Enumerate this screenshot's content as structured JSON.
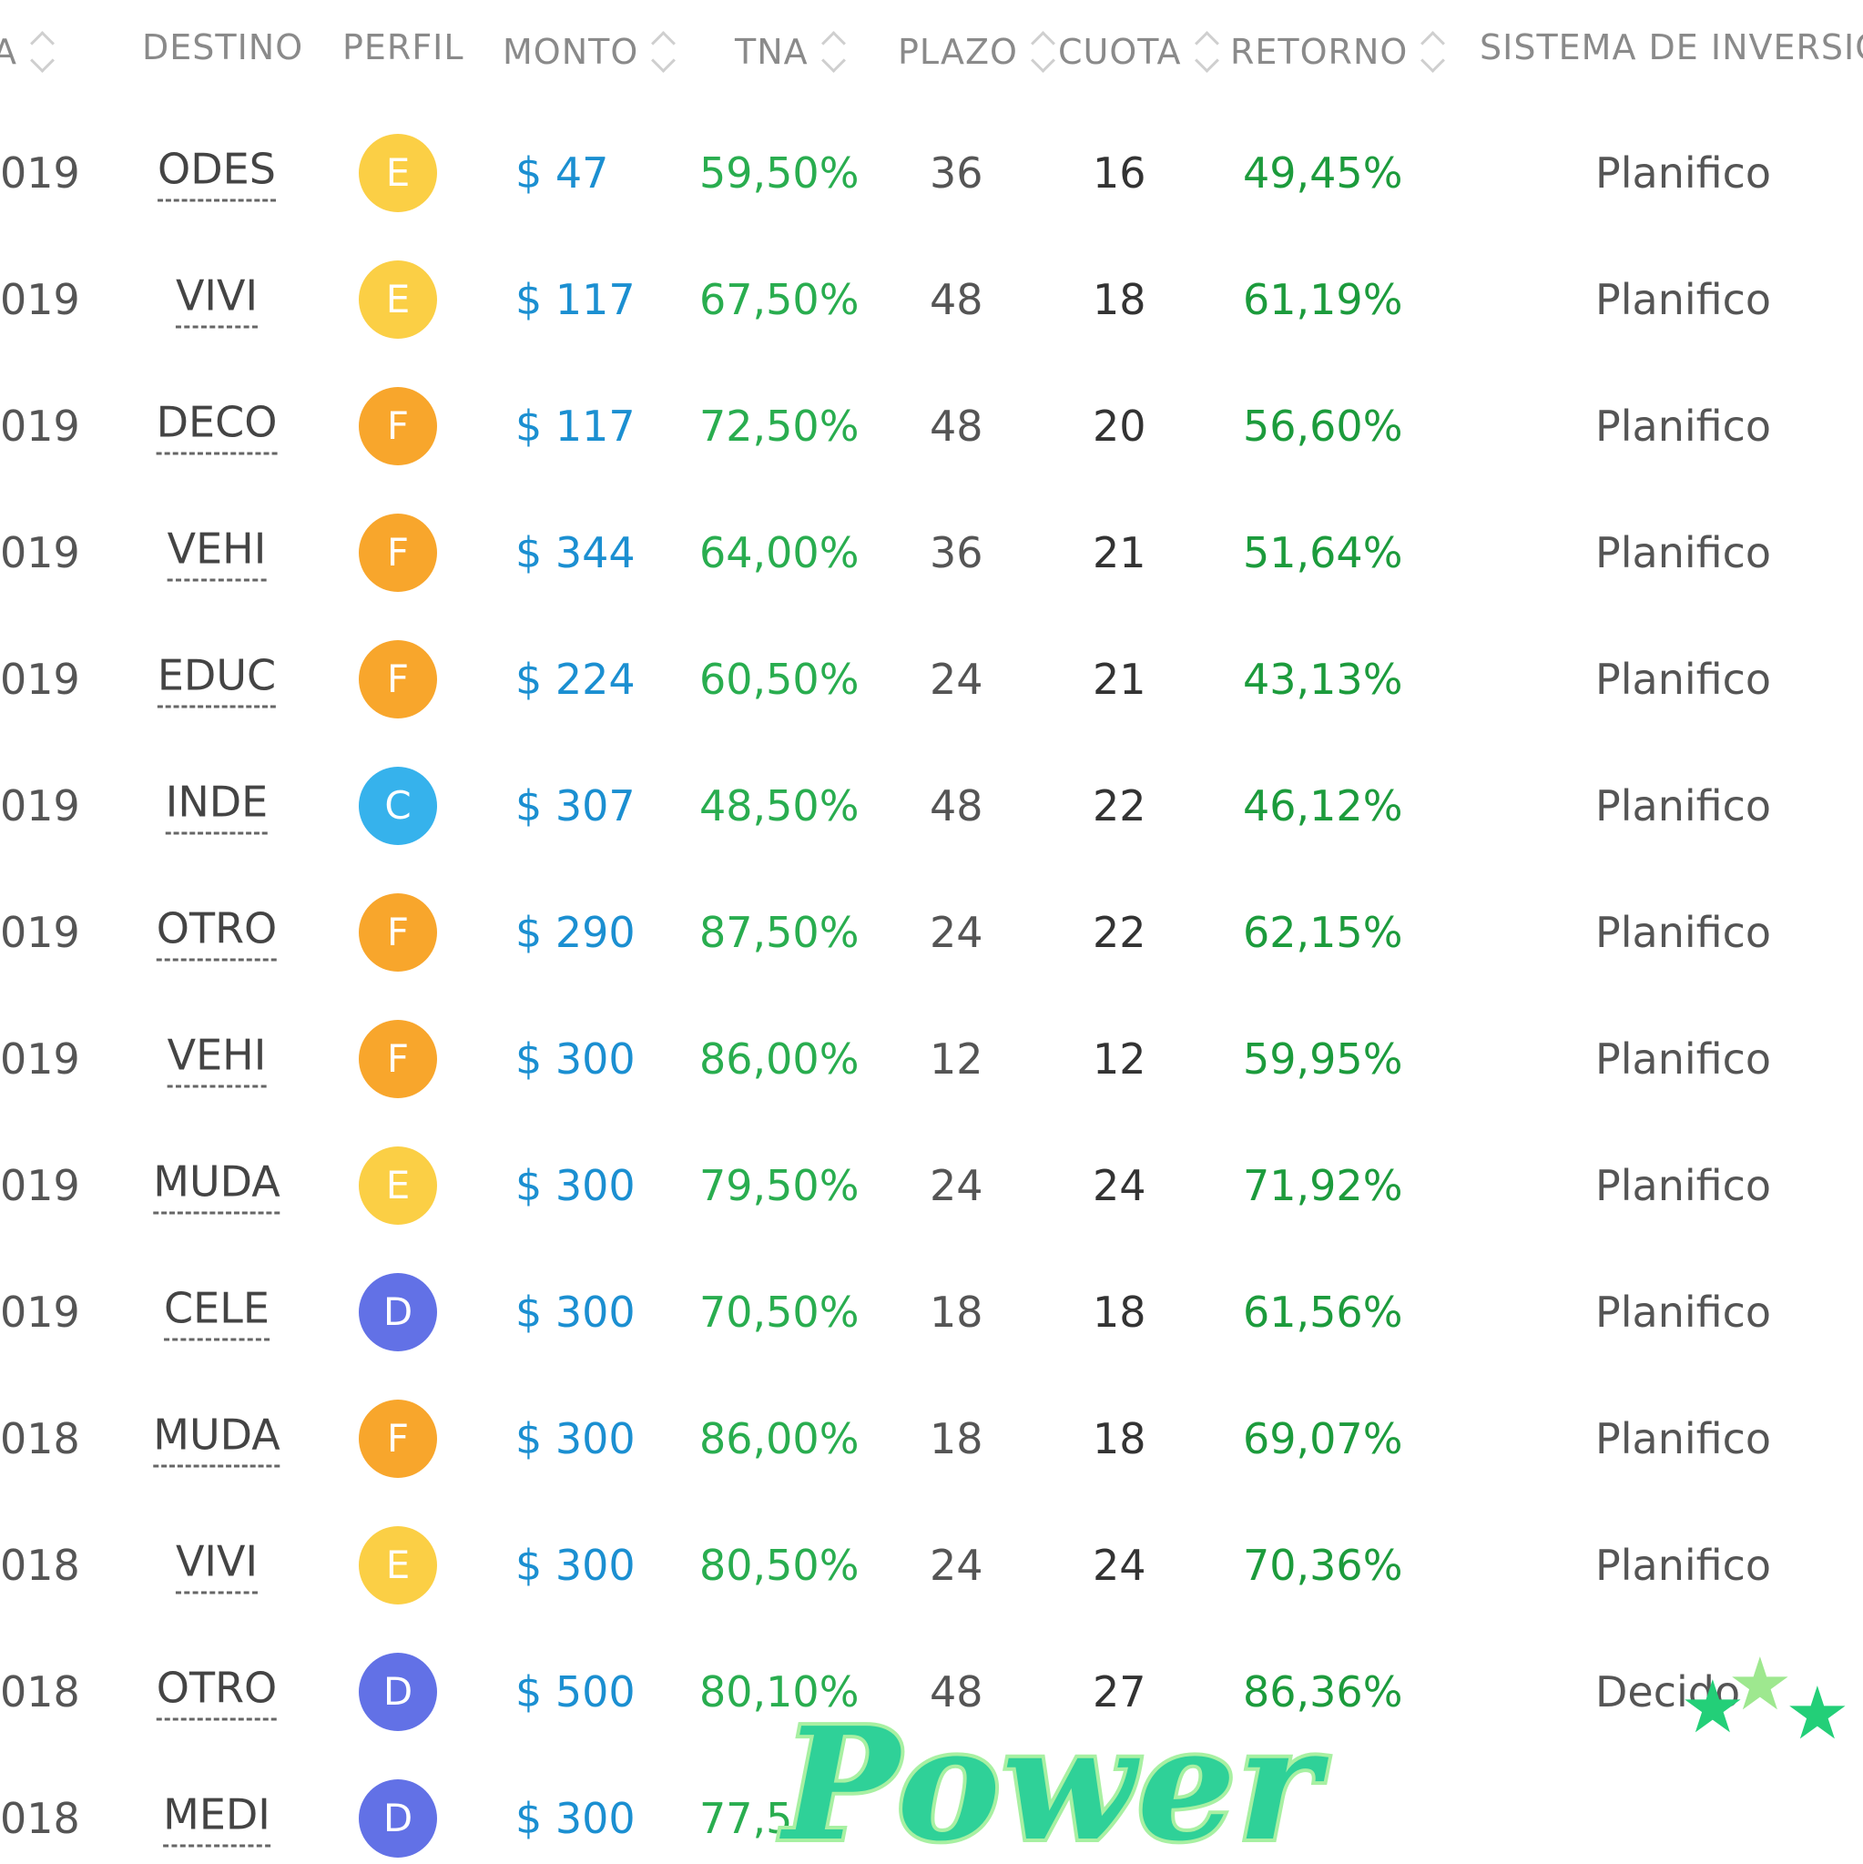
{
  "headers": [
    {
      "label": "A",
      "sortable": true
    },
    {
      "label": "DESTINO",
      "sortable": false
    },
    {
      "label": "PERFIL",
      "sortable": false
    },
    {
      "label": "MONTO",
      "sortable": true
    },
    {
      "label": "TNA",
      "sortable": true
    },
    {
      "label": "PLAZO",
      "sortable": true
    },
    {
      "label": "CUOTA",
      "sortable": true
    },
    {
      "label": "RETORNO",
      "sortable": true
    },
    {
      "label": "SISTEMA DE INVERSIÓN",
      "sortable": false
    }
  ],
  "profile_colors": {
    "C": "#36b2ec",
    "D": "#6271e6",
    "E": "#fbcf45",
    "F": "#f8a62c"
  },
  "rows": [
    {
      "date": "019",
      "destino": "ODES",
      "perfil": "E",
      "monto": "$ 47",
      "tna": "59,50%",
      "plazo": "36",
      "cuota": "16",
      "retorno": "49,45%",
      "sistema": "Planifico"
    },
    {
      "date": "019",
      "destino": "VIVI",
      "perfil": "E",
      "monto": "$ 117",
      "tna": "67,50%",
      "plazo": "48",
      "cuota": "18",
      "retorno": "61,19%",
      "sistema": "Planifico"
    },
    {
      "date": "019",
      "destino": "DECO",
      "perfil": "F",
      "monto": "$ 117",
      "tna": "72,50%",
      "plazo": "48",
      "cuota": "20",
      "retorno": "56,60%",
      "sistema": "Planifico"
    },
    {
      "date": "019",
      "destino": "VEHI",
      "perfil": "F",
      "monto": "$ 344",
      "tna": "64,00%",
      "plazo": "36",
      "cuota": "21",
      "retorno": "51,64%",
      "sistema": "Planifico"
    },
    {
      "date": "019",
      "destino": "EDUC",
      "perfil": "F",
      "monto": "$ 224",
      "tna": "60,50%",
      "plazo": "24",
      "cuota": "21",
      "retorno": "43,13%",
      "sistema": "Planifico"
    },
    {
      "date": "019",
      "destino": "INDE",
      "perfil": "C",
      "monto": "$ 307",
      "tna": "48,50%",
      "plazo": "48",
      "cuota": "22",
      "retorno": "46,12%",
      "sistema": "Planifico"
    },
    {
      "date": "019",
      "destino": "OTRO",
      "perfil": "F",
      "monto": "$ 290",
      "tna": "87,50%",
      "plazo": "24",
      "cuota": "22",
      "retorno": "62,15%",
      "sistema": "Planifico"
    },
    {
      "date": "019",
      "destino": "VEHI",
      "perfil": "F",
      "monto": "$ 300",
      "tna": "86,00%",
      "plazo": "12",
      "cuota": "12",
      "retorno": "59,95%",
      "sistema": "Planifico"
    },
    {
      "date": "019",
      "destino": "MUDA",
      "perfil": "E",
      "monto": "$ 300",
      "tna": "79,50%",
      "plazo": "24",
      "cuota": "24",
      "retorno": "71,92%",
      "sistema": "Planifico"
    },
    {
      "date": "019",
      "destino": "CELE",
      "perfil": "D",
      "monto": "$ 300",
      "tna": "70,50%",
      "plazo": "18",
      "cuota": "18",
      "retorno": "61,56%",
      "sistema": "Planifico"
    },
    {
      "date": "018",
      "destino": "MUDA",
      "perfil": "F",
      "monto": "$ 300",
      "tna": "86,00%",
      "plazo": "18",
      "cuota": "18",
      "retorno": "69,07%",
      "sistema": "Planifico"
    },
    {
      "date": "018",
      "destino": "VIVI",
      "perfil": "E",
      "monto": "$ 300",
      "tna": "80,50%",
      "plazo": "24",
      "cuota": "24",
      "retorno": "70,36%",
      "sistema": "Planifico"
    },
    {
      "date": "018",
      "destino": "OTRO",
      "perfil": "D",
      "monto": "$ 500",
      "tna": "80,10%",
      "plazo": "48",
      "cuota": "27",
      "retorno": "86,36%",
      "sistema": "Decido"
    },
    {
      "date": "018",
      "destino": "MEDI",
      "perfil": "D",
      "monto": "$ 300",
      "tna": "77,5",
      "plazo": "",
      "cuota": "",
      "retorno": "",
      "sistema": ""
    }
  ],
  "watermark": {
    "text": "Power"
  },
  "star_icon": "star-icon"
}
